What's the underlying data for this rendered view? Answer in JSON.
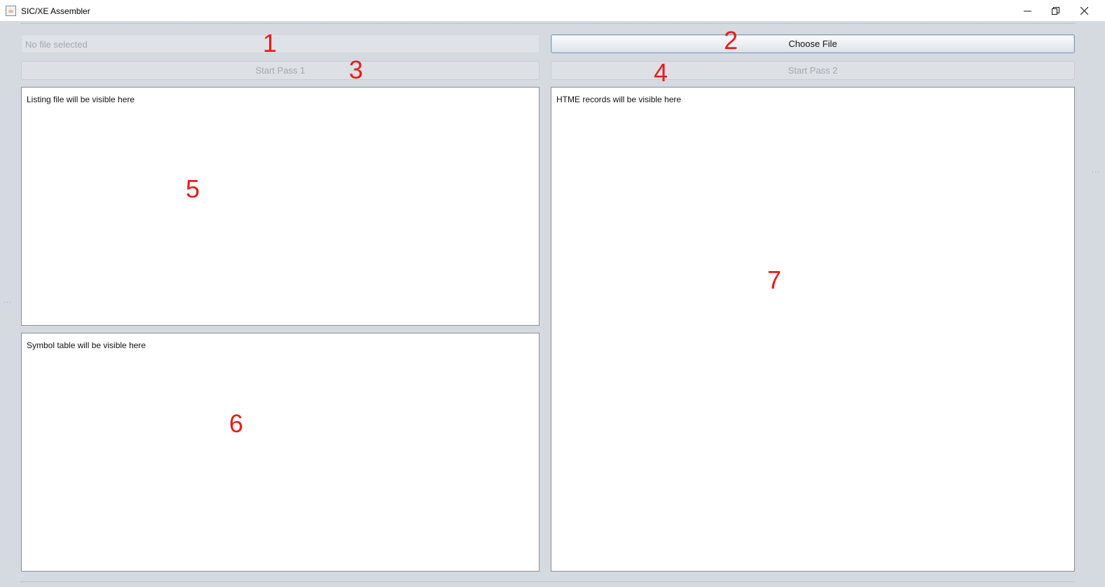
{
  "window": {
    "title": "SIC/XE Assembler",
    "icon": "java-cup-icon",
    "controls": {
      "minimize": "minimize-icon",
      "restore": "restore-icon",
      "close": "close-icon"
    }
  },
  "file_field": {
    "placeholder": "No file selected"
  },
  "buttons": {
    "choose_file": "Choose File",
    "start_pass_1": "Start Pass 1",
    "start_pass_2": "Start Pass 2"
  },
  "areas": {
    "listing": "Listing file will be visible here",
    "symbol_table": "Symbol table will be visible here",
    "htme": "HTME records will be visible here"
  },
  "annotations": [
    "1",
    "2",
    "3",
    "4",
    "5",
    "6",
    "7"
  ],
  "colors": {
    "annotation": "#e81c1c",
    "background": "#d5d9e0",
    "disabled_text": "#a3a8b0"
  }
}
